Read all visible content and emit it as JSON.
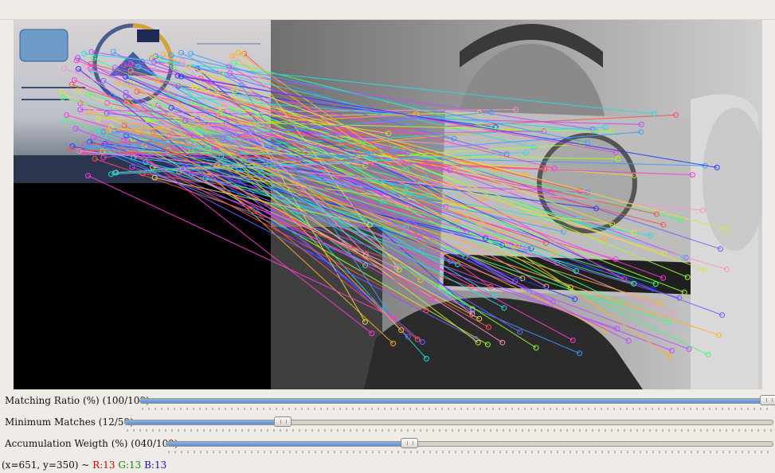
{
  "sliders": [
    {
      "label": "Matching Ratio (%) (100/100)",
      "value": 100,
      "max": 100
    },
    {
      "label": "Minimum Matches (12/50)",
      "value": 12,
      "max": 50
    },
    {
      "label": "Accumulation Weigth (%) (040/100)",
      "value": 40,
      "max": 100
    }
  ],
  "status": {
    "coords": "(x=651, y=350) ~",
    "r": "R:13",
    "g": "G:13",
    "b": "B:13"
  },
  "colors": {
    "background": "#efece7",
    "slider_fill": "#5a8dd0",
    "status_r": "#d40000",
    "status_g": "#0a8a0a",
    "status_b": "#1010d0"
  }
}
